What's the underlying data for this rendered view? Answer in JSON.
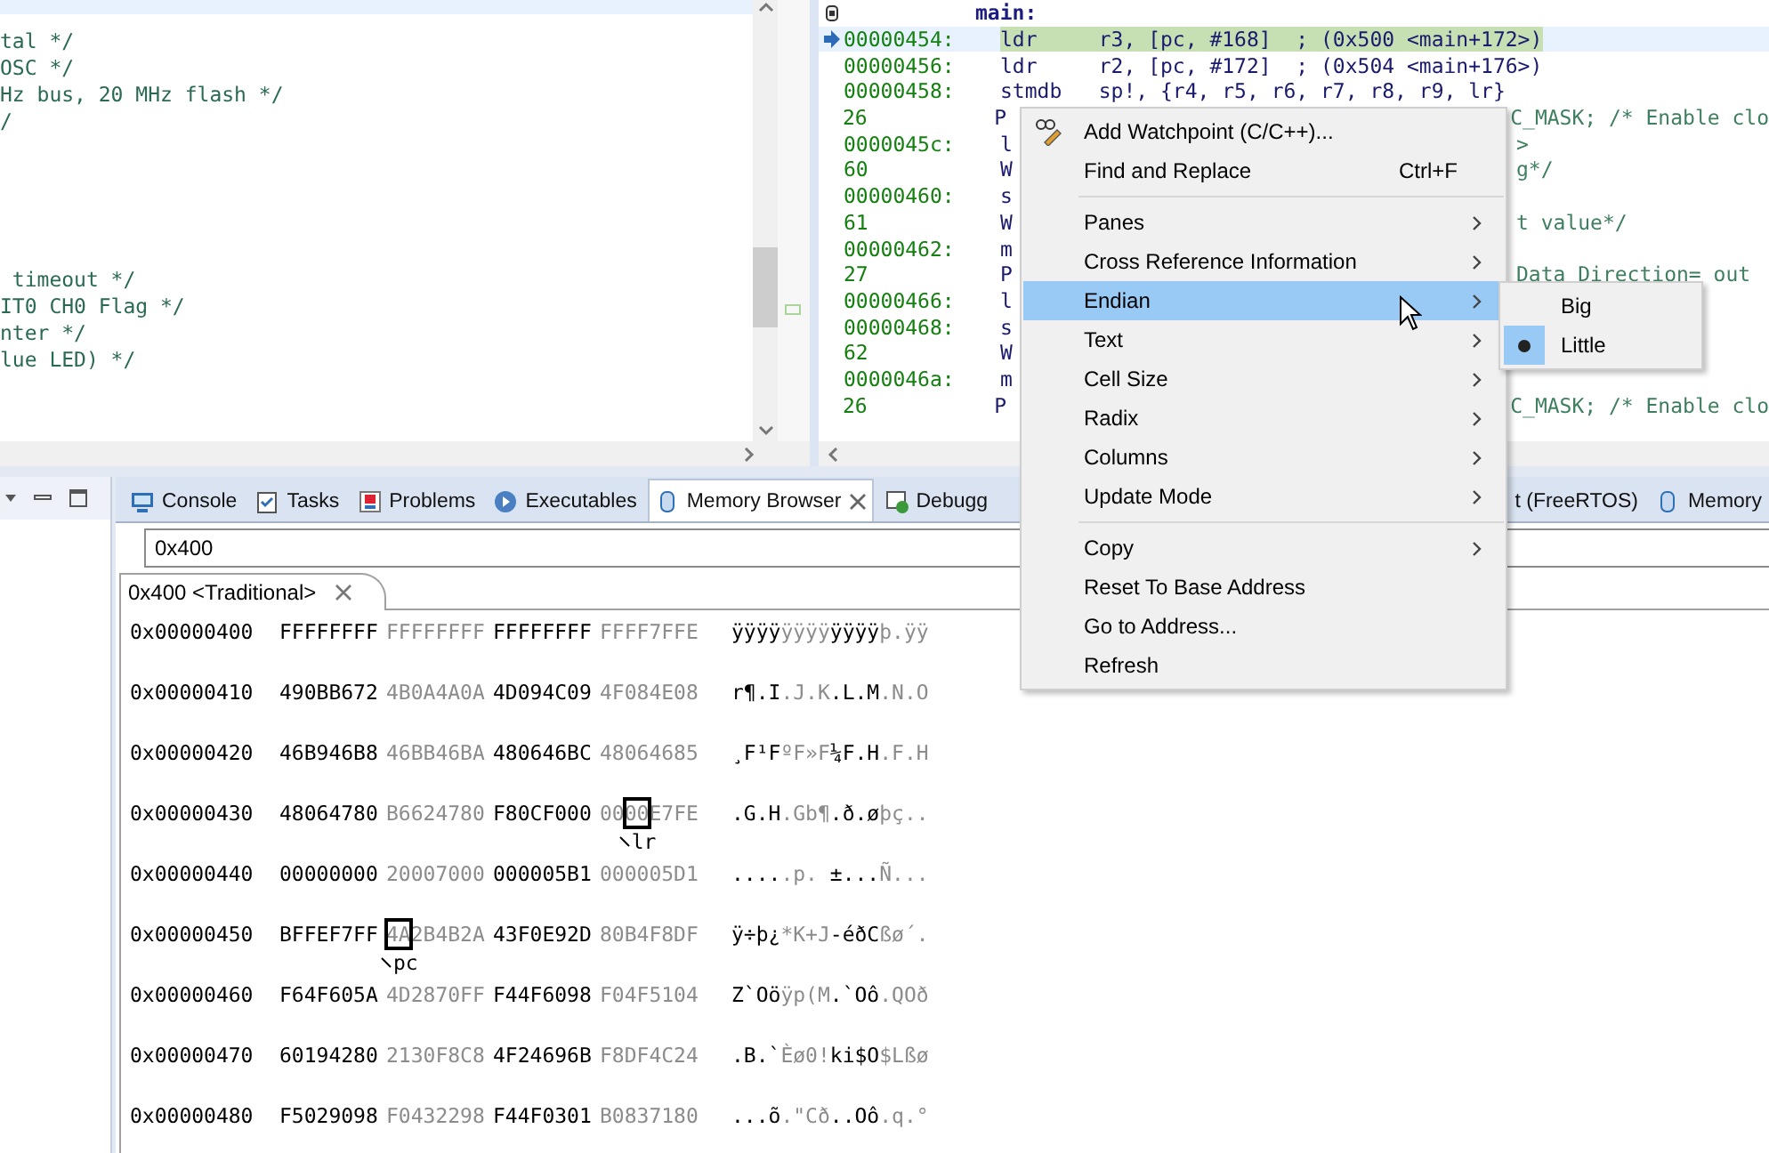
{
  "editor": {
    "blocks": [
      [
        "tal */",
        "OSC */",
        "Hz bus, 20 MHz flash */",
        "/"
      ],
      [
        " timeout */",
        "IT0 CH0 Flag */",
        "nter */",
        "lue LED) */"
      ]
    ]
  },
  "disassembly": {
    "rows": [
      {
        "kind": "label",
        "text": "main:"
      },
      {
        "kind": "code",
        "address": "00000454:",
        "code": "ldr     r3, [pc, #168]  ; (0x500 <main+172>)",
        "current": true
      },
      {
        "kind": "code",
        "address": "00000456:",
        "code": "ldr     r2, [pc, #172]  ; (0x504 <main+176>)",
        "current": false
      },
      {
        "kind": "code",
        "address": "00000458:",
        "code": "stmdb   sp!, {r4, r5, r6, r7, r8, r9, lr}",
        "current": false
      },
      {
        "kind": "code",
        "address": "26",
        "code": "P",
        "tail": "C_MASK; /* Enable clo",
        "current": false
      },
      {
        "kind": "code",
        "address": "0000045c:",
        "code": "l",
        "tail": ">",
        "current": false
      },
      {
        "kind": "code",
        "address": "60",
        "code": "W",
        "tail": "g*/",
        "current": false
      },
      {
        "kind": "code",
        "address": "00000460:",
        "code": "s",
        "current": false
      },
      {
        "kind": "code",
        "address": "61",
        "code": "W",
        "tail": "t value*/",
        "current": false
      },
      {
        "kind": "code",
        "address": "00000462:",
        "code": "m",
        "current": false
      },
      {
        "kind": "code",
        "address": "27",
        "code": "P",
        "tail": "Data Direction= out",
        "current": false
      },
      {
        "kind": "code",
        "address": "00000466:",
        "code": "l",
        "current": false
      },
      {
        "kind": "code",
        "address": "00000468:",
        "code": "s",
        "current": false
      },
      {
        "kind": "code",
        "address": "62",
        "code": "W",
        "current": false
      },
      {
        "kind": "code",
        "address": "0000046a:",
        "code": "m",
        "current": false
      },
      {
        "kind": "code",
        "address": "26",
        "code": "P",
        "tail": "C_MASK; /* Enable clo",
        "current": false
      }
    ]
  },
  "views": {
    "tabs": [
      {
        "kind": "console",
        "label": "Console",
        "selected": false
      },
      {
        "kind": "tasks",
        "label": "Tasks",
        "selected": false
      },
      {
        "kind": "problems",
        "label": "Problems",
        "selected": false
      },
      {
        "kind": "executables",
        "label": "Executables",
        "selected": false
      },
      {
        "kind": "memory",
        "label": "Memory Browser",
        "selected": true
      },
      {
        "kind": "debug",
        "label": "Debugg",
        "selected": false
      },
      {
        "kind": "plain",
        "label": "t (FreeRTOS)",
        "selected": false
      },
      {
        "kind": "memory",
        "label": "Memory",
        "selected": false
      }
    ]
  },
  "address": {
    "value": "0x400"
  },
  "renderings": [
    {
      "label": "0x400 <Traditional>",
      "selected": true
    }
  ],
  "memory": {
    "rows": [
      {
        "address": "0x00000400",
        "words": [
          "FFFFFFFF",
          "FFFFFFFF",
          "FFFFFFFF",
          "FFFF7FFE"
        ],
        "ascii": [
          "ÿÿÿÿ",
          "ÿÿÿÿ",
          "ÿÿÿÿ",
          "þ.ÿÿ"
        ]
      },
      {
        "address": "0x00000410",
        "words": [
          "490BB672",
          "4B0A4A0A",
          "4D094C09",
          "4F084E08"
        ],
        "ascii": [
          "r¶.I",
          ".J.K",
          ".L.M",
          ".N.O"
        ]
      },
      {
        "address": "0x00000420",
        "words": [
          "46B946B8",
          "46BB46BA",
          "480646BC",
          "48064685"
        ],
        "ascii": [
          "¸F¹F",
          "ºF»F",
          "¼F.H",
          ".F.H"
        ]
      },
      {
        "address": "0x00000430",
        "words": [
          "48064780",
          "B6624780",
          "F80CF000",
          {
            "before": "00",
            "boxed": "00",
            "after": "E7FE",
            "pointer": "lr"
          }
        ],
        "ascii": [
          ".G.H",
          ".Gb¶",
          ".ð.ø",
          "þç.."
        ]
      },
      {
        "address": "0x00000440",
        "words": [
          "00000000",
          "20007000",
          "000005B1",
          "000005D1"
        ],
        "ascii": [
          "....",
          ".p. ",
          "±...",
          "Ñ..."
        ]
      },
      {
        "address": "0x00000450",
        "words": [
          "BFFEF7FF",
          {
            "boxed": "4A",
            "after": "2B4B2A",
            "pointer": "pc"
          },
          "43F0E92D",
          "80B4F8DF"
        ],
        "ascii": [
          "ÿ÷þ¿",
          "*K+J",
          "-éðC",
          "ßø´."
        ]
      },
      {
        "address": "0x00000460",
        "words": [
          "F64F605A",
          "4D2870FF",
          "F44F6098",
          "F04F5104"
        ],
        "ascii": [
          "Z`Oö",
          "ÿp(M",
          ".`Oô",
          ".QOð"
        ]
      },
      {
        "address": "0x00000470",
        "words": [
          "60194280",
          "2130F8C8",
          "4F24696B",
          "F8DF4C24"
        ],
        "ascii": [
          ".B.`",
          "Èø0!",
          "ki$O",
          "$Lßø"
        ]
      },
      {
        "address": "0x00000480",
        "words": [
          "F5029098",
          "F0432298",
          "F44F0301",
          "B0837180"
        ],
        "ascii": [
          "...õ",
          ".\"Cð",
          "..Oô",
          ".q.°"
        ]
      }
    ]
  },
  "context_menu": {
    "items": [
      {
        "kind": "action",
        "label": "Add Watchpoint (C/C++)...",
        "icon": true,
        "selected": false
      },
      {
        "kind": "action",
        "label": "Find and Replace",
        "shortcut": "Ctrl+F",
        "selected": false
      },
      {
        "kind": "separator"
      },
      {
        "kind": "submenu",
        "label": "Panes",
        "selected": false
      },
      {
        "kind": "submenu",
        "label": "Cross Reference Information",
        "selected": false
      },
      {
        "kind": "submenu",
        "label": "Endian",
        "selected": true
      },
      {
        "kind": "submenu",
        "label": "Text",
        "selected": false
      },
      {
        "kind": "submenu",
        "label": "Cell Size",
        "selected": false
      },
      {
        "kind": "submenu",
        "label": "Radix",
        "selected": false
      },
      {
        "kind": "submenu",
        "label": "Columns",
        "selected": false
      },
      {
        "kind": "submenu",
        "label": "Update Mode",
        "selected": false
      },
      {
        "kind": "separator"
      },
      {
        "kind": "submenu",
        "label": "Copy",
        "selected": false
      },
      {
        "kind": "action",
        "label": "Reset To Base Address",
        "selected": false
      },
      {
        "kind": "action",
        "label": "Go to Address...",
        "selected": false
      },
      {
        "kind": "action",
        "label": "Refresh",
        "selected": false
      }
    ]
  },
  "endian_submenu": {
    "items": [
      {
        "label": "Big",
        "selected": false
      },
      {
        "label": "Little",
        "selected": true
      }
    ]
  }
}
